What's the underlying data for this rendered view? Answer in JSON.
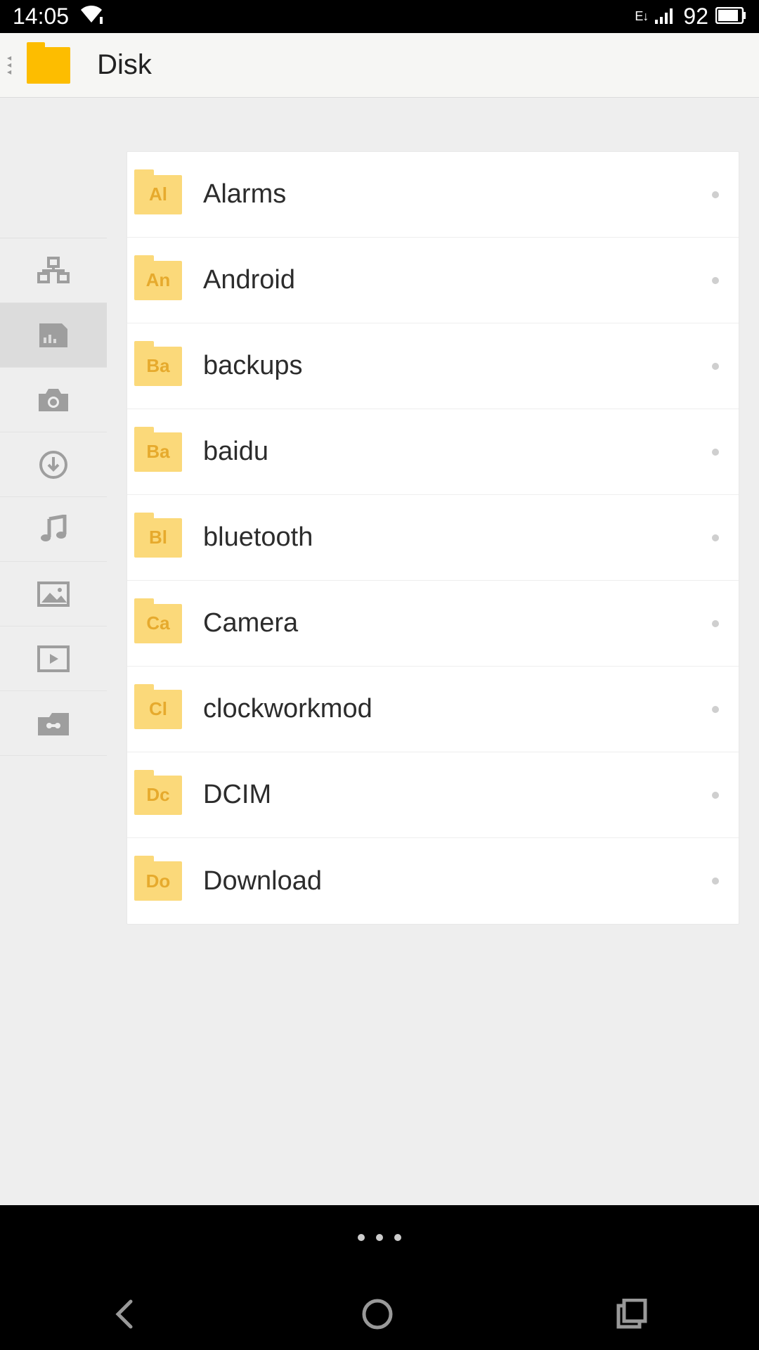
{
  "status": {
    "time": "14:05",
    "battery": "92"
  },
  "header": {
    "title": "Disk"
  },
  "sidebar": {
    "items": [
      {
        "id": "lan"
      },
      {
        "id": "storage"
      },
      {
        "id": "photos"
      },
      {
        "id": "downloads"
      },
      {
        "id": "music"
      },
      {
        "id": "pictures"
      },
      {
        "id": "videos"
      },
      {
        "id": "hidden"
      }
    ],
    "active_index": 1
  },
  "folders": [
    {
      "abbr": "Al",
      "name": "Alarms"
    },
    {
      "abbr": "An",
      "name": "Android"
    },
    {
      "abbr": "Ba",
      "name": "backups"
    },
    {
      "abbr": "Ba",
      "name": "baidu"
    },
    {
      "abbr": "Bl",
      "name": "bluetooth"
    },
    {
      "abbr": "Ca",
      "name": "Camera"
    },
    {
      "abbr": "Cl",
      "name": "clockworkmod"
    },
    {
      "abbr": "Dc",
      "name": "DCIM"
    },
    {
      "abbr": "Do",
      "name": "Download"
    }
  ]
}
